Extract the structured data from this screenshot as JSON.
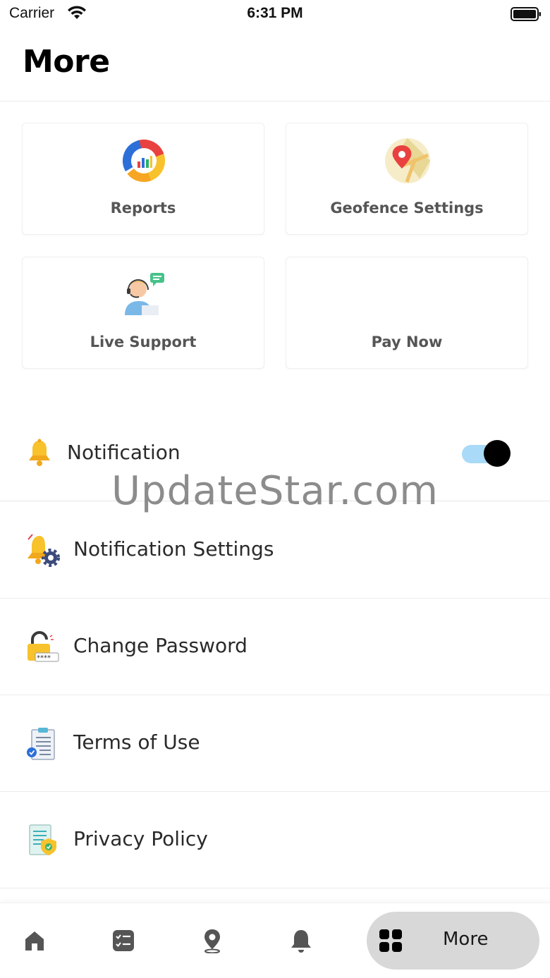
{
  "status_bar": {
    "carrier": "Carrier",
    "time": "6:31 PM"
  },
  "page": {
    "title": "More"
  },
  "tiles": [
    {
      "label": "Reports",
      "icon": "reports-chart-icon"
    },
    {
      "label": "Geofence Settings",
      "icon": "map-pin-icon"
    },
    {
      "label": "Live Support",
      "icon": "support-agent-icon"
    },
    {
      "label": "Pay Now",
      "icon": ""
    }
  ],
  "notification": {
    "label": "Notification",
    "enabled": true,
    "icon": "bell-icon"
  },
  "settings_rows": [
    {
      "label": "Notification Settings",
      "icon": "bell-gear-icon"
    },
    {
      "label": "Change Password",
      "icon": "padlock-icon"
    },
    {
      "label": "Terms of Use",
      "icon": "clipboard-icon"
    },
    {
      "label": "Privacy Policy",
      "icon": "document-shield-icon"
    }
  ],
  "watermark": "UpdateStar.com",
  "tabbar": {
    "items": [
      {
        "name": "home",
        "icon": "home-icon"
      },
      {
        "name": "tasks",
        "icon": "checklist-icon"
      },
      {
        "name": "location",
        "icon": "location-pin-icon"
      },
      {
        "name": "alerts",
        "icon": "bell-icon"
      }
    ],
    "more_label": "More"
  },
  "colors": {
    "toggle_track": "#a9daf7",
    "toggle_knob": "#000000",
    "accent_yellow": "#f8c22d",
    "active_tab_bg": "#d8d8d8"
  }
}
